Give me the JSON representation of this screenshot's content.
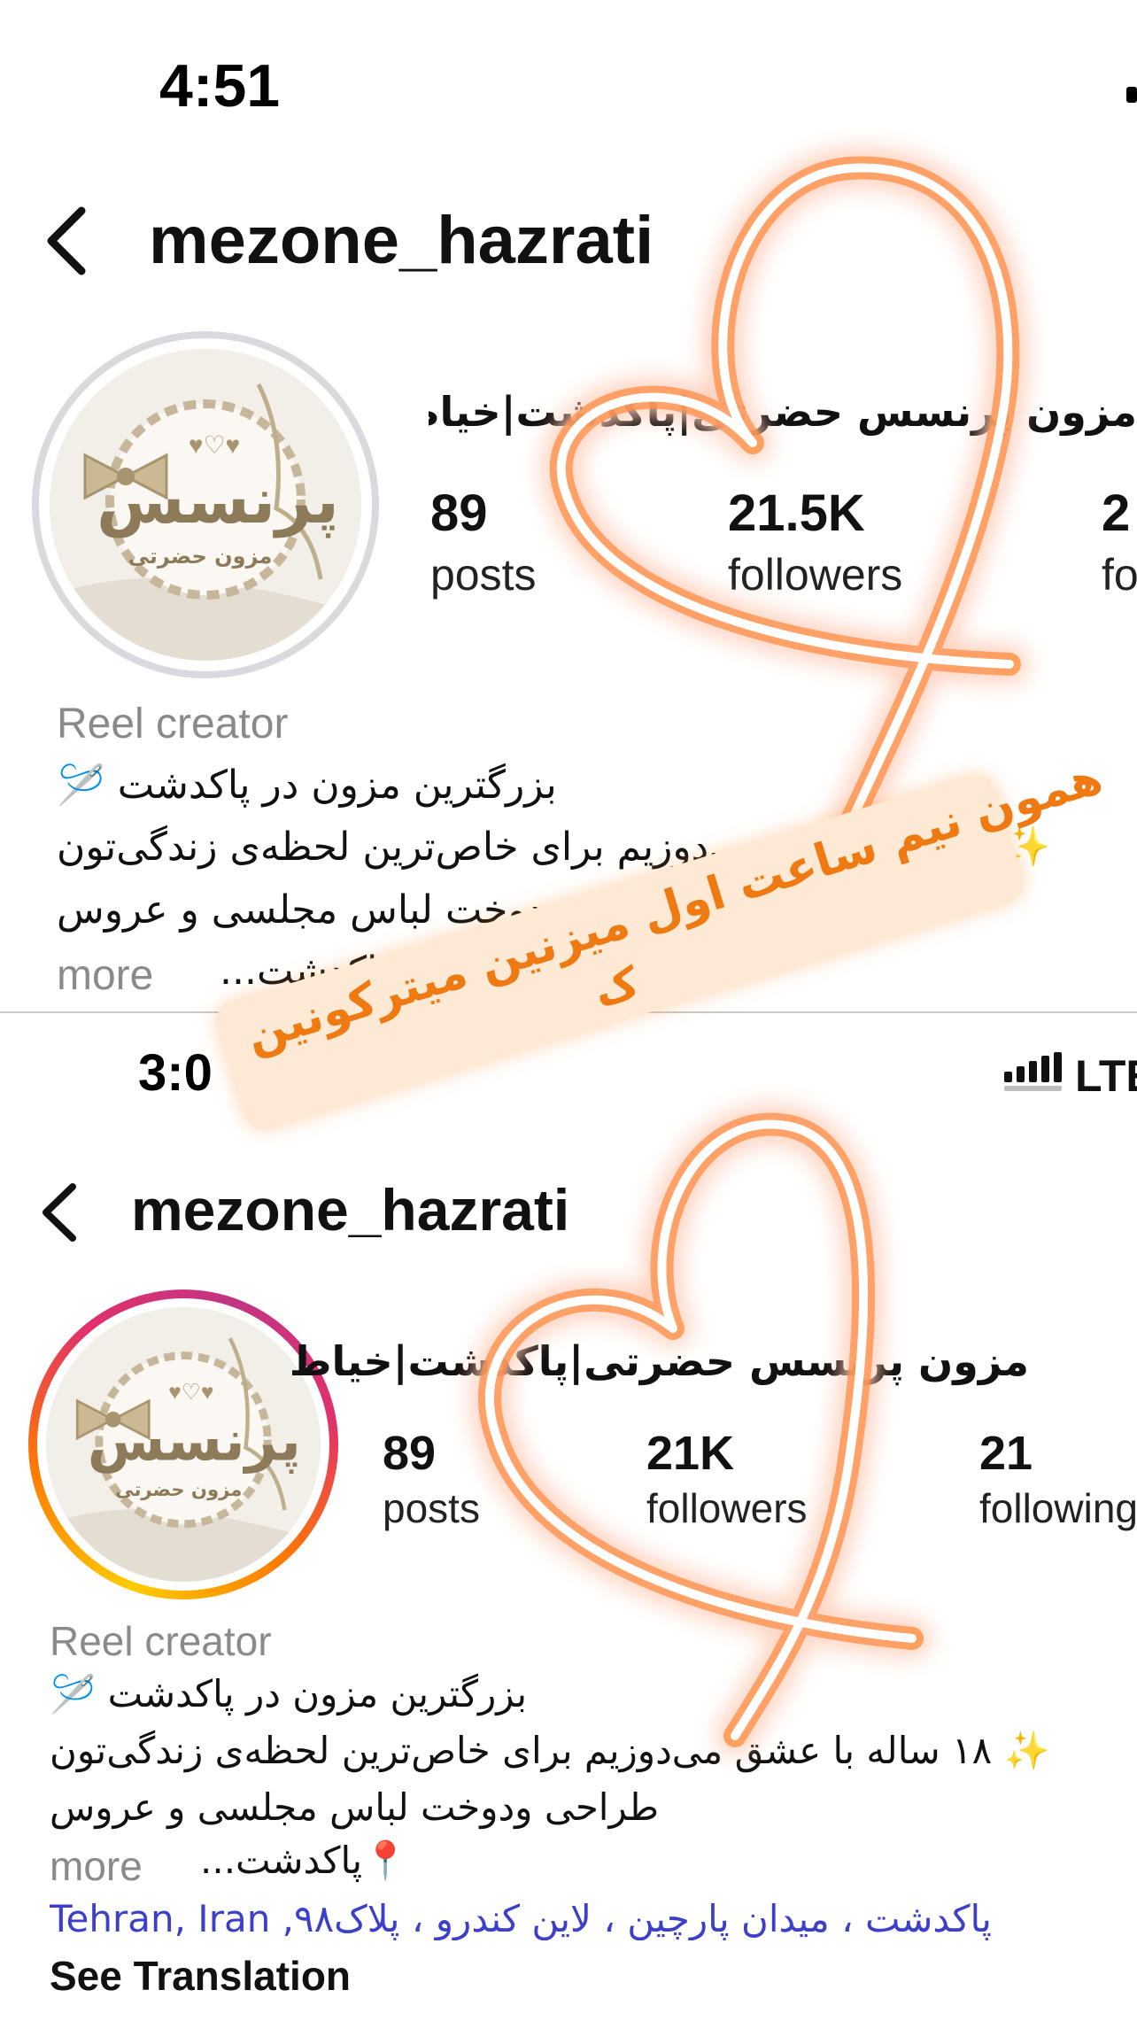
{
  "top_screenshot": {
    "status_time": "4:51",
    "username": "mezone_hazrati",
    "display_name": "مزون پرنسس حضرتی|پاکدشت|خیاط",
    "stats": {
      "posts_count": "89",
      "posts_label": "posts",
      "followers_count": "21.5K",
      "followers_label": "followers",
      "following_count": "2",
      "following_label": "fo"
    },
    "category": "Reel creator",
    "bio_lines": [
      "بزرگترین مزون در پاکدشت 🪡",
      "✨ ساله با عشق می‌دوزیم برای خاص‌ترین لحظه‌ی زندگی‌تون",
      "طراحی ودوخت لباس مجلسی و عروس"
    ],
    "bio_more_prefix": "📍پاکدشت...",
    "more_label": "more",
    "avatar_logo_text": "پرنسس",
    "avatar_sub_text": "مزون حضرتی"
  },
  "bottom_screenshot": {
    "status_time": "3:0",
    "network_label": "LTE",
    "username": "mezone_hazrati",
    "display_name": "مزون پرنسس حضرتی|پاکدشت|خیاط",
    "stats": {
      "posts_count": "89",
      "posts_label": "posts",
      "followers_count": "21K",
      "followers_label": "followers",
      "following_count": "21",
      "following_label": "following"
    },
    "category": "Reel creator",
    "bio_lines": [
      "بزرگترین مزون در پاکدشت 🪡",
      "✨ ۱۸ ساله با عشق می‌دوزیم برای خاص‌ترین لحظه‌ی زندگی‌تون",
      "طراحی ودوخت لباس مجلسی و عروس"
    ],
    "bio_more_prefix": "📍پاکدشت...",
    "more_label": "more",
    "location_link": "پاکدشت ، میدان پارچین ، لاین کندرو ، پلاک۹۸, Tehran, Iran",
    "see_translation": "See Translation",
    "avatar_logo_text": "پرنسس",
    "avatar_sub_text": "مزون حضرتی"
  },
  "sticker": {
    "line1": "همون نیم ساعت اول میزنین میترکونین",
    "line2": "ک"
  },
  "colors": {
    "neon_orange": "#ff8a1f",
    "story_ring_start": "#ffcc00",
    "story_ring_end": "#e1306c",
    "link_blue": "#3b3fc9",
    "muted_gray": "#8a8a8a"
  },
  "icons": [
    "back-chevron-icon",
    "signal-bars-icon",
    "heart-doodle-icon"
  ]
}
